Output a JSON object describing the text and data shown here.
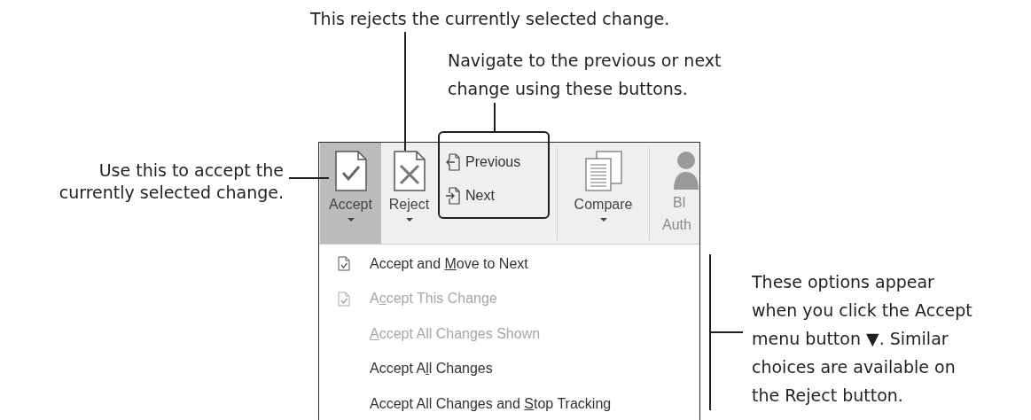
{
  "callouts": [
    {
      "kind": "reject",
      "text": "This rejects the currently selected change."
    },
    {
      "kind": "navigation",
      "text": "Navigate to the previous or next\nchange using these buttons."
    },
    {
      "kind": "accept",
      "text": "Use this to accept the\ncurrently selected change."
    },
    {
      "kind": "menu",
      "text": "These options appear\nwhen you click the Accept\nmenu button ▼. Similar\nchoices are available on\nthe Reject button."
    }
  ],
  "ribbon": {
    "groups": [
      {
        "kind": "large",
        "label": "Accept",
        "dropdown": true,
        "selected": true
      },
      {
        "kind": "large",
        "label": "Reject",
        "dropdown": true,
        "selected": false
      },
      {
        "kind": "stack",
        "items": [
          {
            "label": "Previous"
          },
          {
            "label": "Next"
          }
        ]
      },
      {
        "kind": "large",
        "label": "Compare",
        "dropdown": true,
        "selected": false
      },
      {
        "kind": "cut",
        "lines": [
          "Bl",
          "Auth"
        ],
        "disabled": true
      }
    ]
  },
  "menu": {
    "items": [
      {
        "before": "Accept and ",
        "key": "M",
        "after": "ove to Next",
        "icon": true,
        "disabled": false
      },
      {
        "before": "A",
        "key": "c",
        "after": "cept This Change",
        "icon": true,
        "disabled": true
      },
      {
        "key": "A",
        "after": "ccept All Changes Shown",
        "icon": false,
        "disabled": true
      },
      {
        "before": "Accept A",
        "key": "l",
        "after": "l Changes",
        "icon": false,
        "disabled": false
      },
      {
        "before": "Accept All Changes and ",
        "key": "S",
        "after": "top Tracking",
        "icon": false,
        "disabled": false
      }
    ]
  }
}
